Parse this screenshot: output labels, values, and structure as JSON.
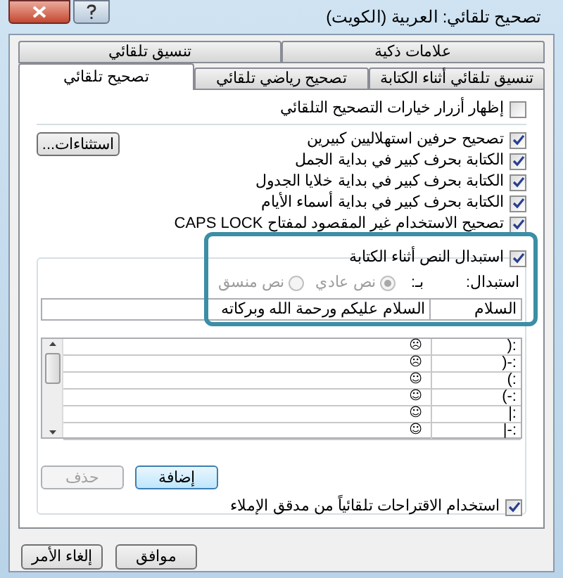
{
  "window": {
    "title": "تصحيح تلقائي: العربية (الكويت)"
  },
  "tabs_top": [
    {
      "label": "علامات ذكية",
      "selected": false
    },
    {
      "label": "تنسيق تلقائي",
      "selected": false
    }
  ],
  "tabs_bottom": [
    {
      "label": "تنسيق تلقائي أثناء الكتابة",
      "selected": false
    },
    {
      "label": "تصحيح رياضي تلقائي",
      "selected": false
    },
    {
      "label": "تصحيح تلقائي",
      "selected": true
    }
  ],
  "show_buttons": {
    "label": "إظهار أزرار خيارات التصحيح التلقائي",
    "checked": false
  },
  "exceptions_button": "استثناءات...",
  "options": [
    {
      "label": "تصحيح حرفين استهلاليين كبيرين",
      "checked": true
    },
    {
      "label": "الكتابة بحرف كبير في بداية الجمل",
      "checked": true
    },
    {
      "label": "الكتابة بحرف كبير في بداية خلايا الجدول",
      "checked": true
    },
    {
      "label": "الكتابة بحرف كبير في بداية أسماء الأيام",
      "checked": true
    },
    {
      "label": "تصحيح الاستخدام غير المقصود لمفتاح CAPS LOCK",
      "checked": true
    }
  ],
  "replace": {
    "label": "استبدال النص أثناء الكتابة",
    "checked": true,
    "replace_label": "استبدال:",
    "with_label": "بـ:",
    "radios": [
      {
        "label": "نص عادي",
        "selected": true,
        "disabled": true
      },
      {
        "label": "نص منسق",
        "selected": false,
        "disabled": true
      }
    ],
    "replace_value": "السلام",
    "with_value": "السلام عليكم ورحمة الله وبركاته"
  },
  "table": {
    "rows": [
      {
        "replace": ":(",
        "with": "☹"
      },
      {
        "replace": ":-(",
        "with": "☹"
      },
      {
        "replace": ":)",
        "with": "☺"
      },
      {
        "replace": ":-)",
        "with": "☺"
      },
      {
        "replace": ":|",
        "with": "☺"
      },
      {
        "replace": ":-|",
        "with": "☺"
      }
    ]
  },
  "add_button": {
    "label": "إضافة",
    "disabled": false
  },
  "delete_button": {
    "label": "حذف",
    "disabled": true
  },
  "spelling": {
    "label": "استخدام الاقتراحات تلقائياً من مدقق الإملاء",
    "checked": true
  },
  "buttons": [
    "موافق",
    "إلغاء الأمر"
  ]
}
